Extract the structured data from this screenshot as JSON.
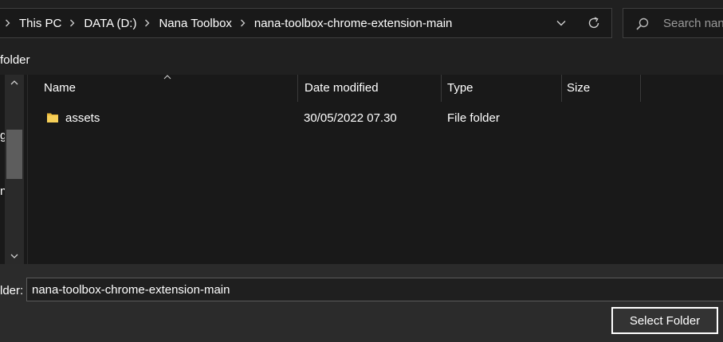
{
  "address_bar": {
    "breadcrumbs": [
      "This PC",
      "DATA (D:)",
      "Nana Toolbox",
      "nana-toolbox-chrome-extension-main"
    ],
    "dropdown_icon": "chevron-down-icon",
    "refresh_icon": "refresh-icon"
  },
  "search": {
    "placeholder": "Search nana",
    "icon": "search-icon"
  },
  "command_row": {
    "label": "folder"
  },
  "nav_pane": {
    "partial_items": [
      "g",
      "n"
    ]
  },
  "file_list": {
    "columns": [
      "Name",
      "Date modified",
      "Type",
      "Size"
    ],
    "sorted_by": "Name",
    "rows": [
      {
        "name": "assets",
        "date_modified": "30/05/2022 07.30",
        "type": "File folder",
        "size": "",
        "icon": "folder-icon"
      }
    ]
  },
  "bottom_bar": {
    "folder_label": "lder:",
    "folder_value": "nana-toolbox-chrome-extension-main",
    "select_button": "Select Folder"
  },
  "colors": {
    "window_bg": "#191919",
    "chrome_bg": "#202020",
    "footer_bg": "#2b2b2b",
    "folder_yellow": "#f3c84a",
    "text": "#ffffff",
    "placeholder": "#9a9a9a"
  }
}
